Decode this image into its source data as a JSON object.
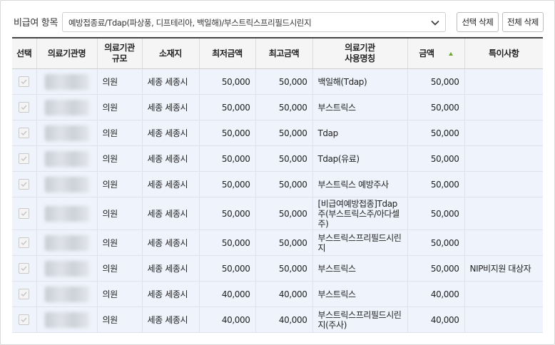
{
  "filter": {
    "label": "비급여 항목",
    "selected": "예방접종료/Tdap(파상풍, 디프테리아, 백일해)/부스트릭스프리필드시린지"
  },
  "buttons": {
    "delete_selected": "선택 삭제",
    "delete_all": "전체 삭제"
  },
  "table": {
    "headers": {
      "select": "선택",
      "name": "의료기관명",
      "size": "의료기관\n규모",
      "location": "소재지",
      "min": "최저금액",
      "max": "최고금액",
      "usage_name": "의료기관\n사용명칭",
      "amount": "금액",
      "note": "특이사항"
    },
    "sort": {
      "column": "amount",
      "direction": "asc",
      "indicator_color": "#6aa832"
    },
    "rows": [
      {
        "size": "의원",
        "location": "세종 세종시",
        "min": "50,000",
        "max": "50,000",
        "usage": "백일해(Tdap)",
        "amount": "50,000",
        "note": ""
      },
      {
        "size": "의원",
        "location": "세종 세종시",
        "min": "50,000",
        "max": "50,000",
        "usage": "부스트릭스",
        "amount": "50,000",
        "note": ""
      },
      {
        "size": "의원",
        "location": "세종 세종시",
        "min": "50,000",
        "max": "50,000",
        "usage": "Tdap",
        "amount": "50,000",
        "note": ""
      },
      {
        "size": "의원",
        "location": "세종 세종시",
        "min": "50,000",
        "max": "50,000",
        "usage": "Tdap(유료)",
        "amount": "50,000",
        "note": ""
      },
      {
        "size": "의원",
        "location": "세종 세종시",
        "min": "50,000",
        "max": "50,000",
        "usage": "부스트릭스 예방주사",
        "amount": "50,000",
        "note": ""
      },
      {
        "size": "의원",
        "location": "세종 세종시",
        "min": "50,000",
        "max": "50,000",
        "usage": "[비급여예방접종]Tdap주(부스트릭스주/아다셀주)",
        "amount": "50,000",
        "note": ""
      },
      {
        "size": "의원",
        "location": "세종 세종시",
        "min": "50,000",
        "max": "50,000",
        "usage": "부스트릭스프리필드시린지",
        "amount": "50,000",
        "note": ""
      },
      {
        "size": "의원",
        "location": "세종 세종시",
        "min": "50,000",
        "max": "50,000",
        "usage": "부스트릭스",
        "amount": "50,000",
        "note": "NIP비지원 대상자"
      },
      {
        "size": "의원",
        "location": "세종 세종시",
        "min": "40,000",
        "max": "40,000",
        "usage": "부스트릭스",
        "amount": "40,000",
        "note": ""
      },
      {
        "size": "의원",
        "location": "세종 세종시",
        "min": "40,000",
        "max": "40,000",
        "usage": "부스트릭스프리필드시린지(주사)",
        "amount": "40,000",
        "note": ""
      }
    ]
  }
}
